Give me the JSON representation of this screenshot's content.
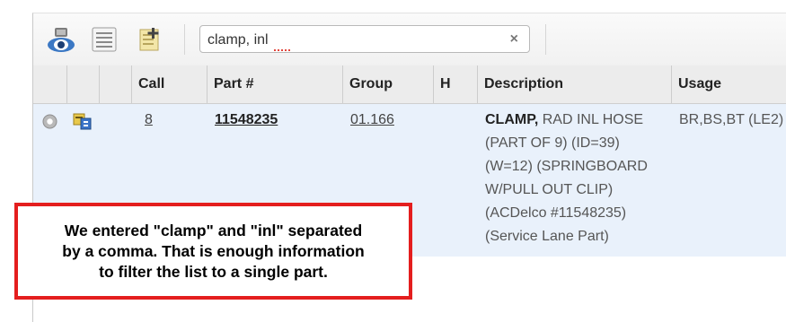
{
  "search": {
    "value": "clamp, inl",
    "clear_icon": "×"
  },
  "toolbar": {
    "icons": [
      "view-icon",
      "list-icon",
      "add-note-icon"
    ]
  },
  "table": {
    "headers": {
      "col1": "",
      "col2": "",
      "col3": "",
      "call": "Call",
      "part": "Part #",
      "group": "Group",
      "h": "H",
      "description": "Description",
      "usage": "Usage"
    },
    "row": {
      "call": "8",
      "part": "11548235",
      "group": "01.166",
      "description_strong": "CLAMP,",
      "description_lines": [
        "RAD INL HOSE",
        "(PART OF 9) (ID=39)",
        "(W=12) (SPRINGBOARD",
        "W/PULL OUT CLIP)",
        "(ACDelco #11548235)",
        "(Service Lane Part)"
      ],
      "usage": "BR,BS,BT (LE2)"
    }
  },
  "callout": {
    "text": "We entered \"clamp\" and \"inl\" separated\nby a comma. That is enough information\nto filter the list to a single part."
  },
  "colors": {
    "row_highlight": "#e9f1fb",
    "callout_border": "#e41e1e"
  }
}
